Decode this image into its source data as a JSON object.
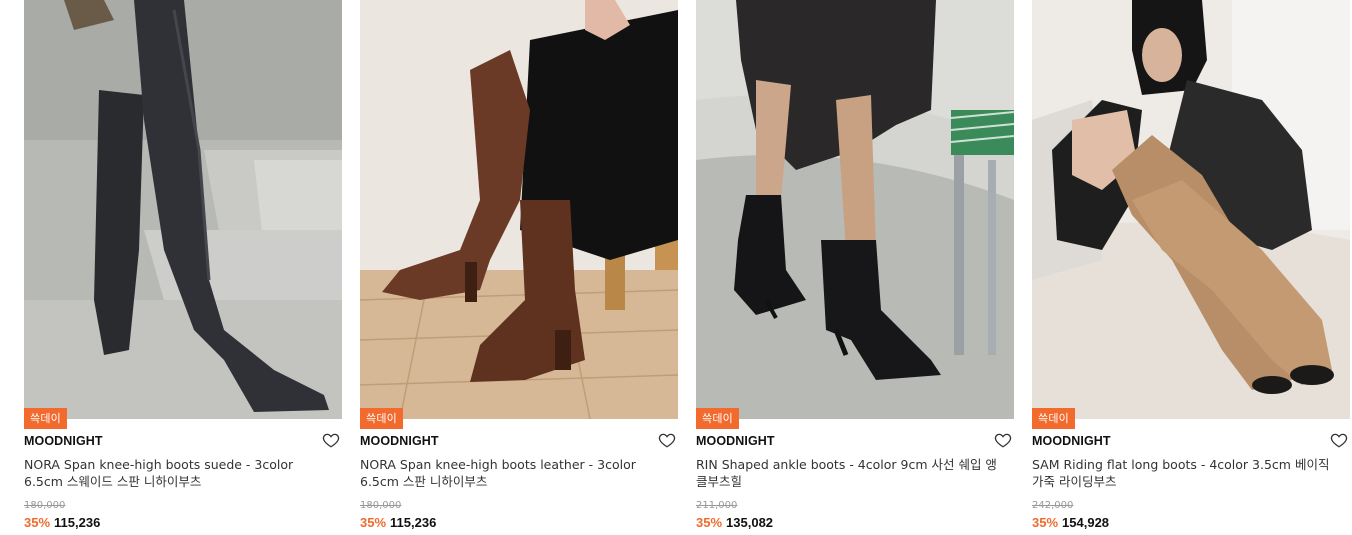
{
  "products": [
    {
      "badge": "쓱데이",
      "brand": "MOODNIGHT",
      "name": "NORA Span knee-high boots suede - 3color 6.5cm 스웨이드 스판 니하이부츠",
      "original_price": "180,000",
      "discount": "35%",
      "price": "115,236",
      "image_alt": "black suede over-the-knee boots on concrete stairs"
    },
    {
      "badge": "쓱데이",
      "brand": "MOODNIGHT",
      "name": "NORA Span knee-high boots leather - 3color 6.5cm 스판 니하이부츠",
      "original_price": "180,000",
      "discount": "35%",
      "price": "115,236",
      "image_alt": "brown leather knee-high boots on wooden floor"
    },
    {
      "badge": "쓱데이",
      "brand": "MOODNIGHT",
      "name": "RIN Shaped ankle boots - 4color 9cm 사선 쉐입 앵클부츠힐",
      "original_price": "211,000",
      "discount": "35%",
      "price": "135,082",
      "image_alt": "black heeled ankle boots beside chrome chair"
    },
    {
      "badge": "쓱데이",
      "brand": "MOODNIGHT",
      "name": "SAM Riding flat long boots - 4color 3.5cm 베이직 가죽 라이딩부츠",
      "original_price": "242,000",
      "discount": "35%",
      "price": "154,928",
      "image_alt": "model in beige suede riding boots on white sofa"
    }
  ],
  "colors": {
    "accent": "#f26a2e"
  },
  "icons": {
    "wishlist": "heart-outline-icon"
  }
}
